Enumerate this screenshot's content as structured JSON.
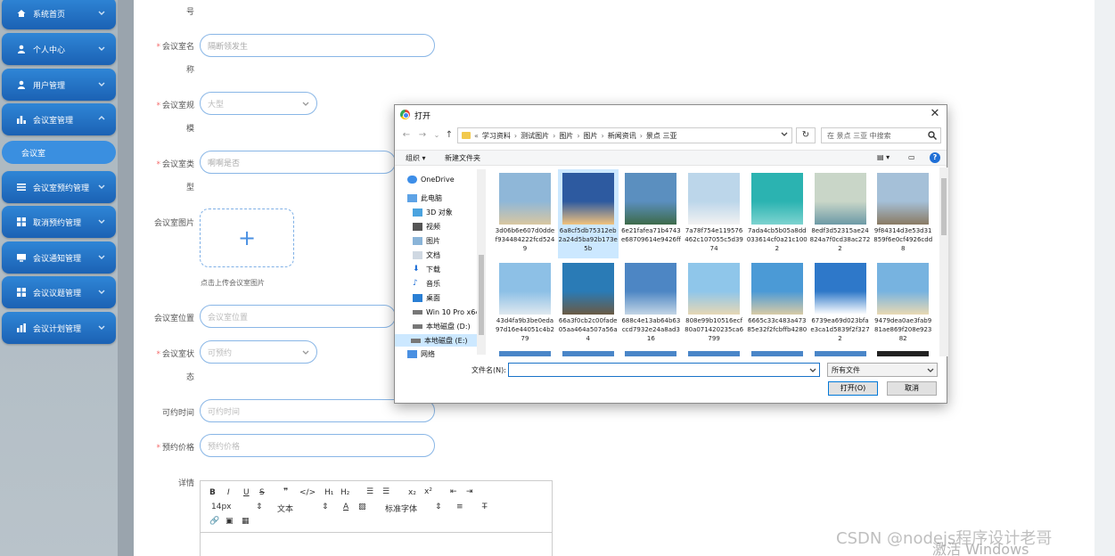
{
  "sidebar": {
    "items": [
      {
        "label": "系统首页",
        "icon": "home-icon"
      },
      {
        "label": "个人中心",
        "icon": "user-icon"
      },
      {
        "label": "用户管理",
        "icon": "user-icon"
      },
      {
        "label": "会议室管理",
        "icon": "chart-icon"
      },
      {
        "label": "会议室预约管理",
        "icon": "list-icon"
      },
      {
        "label": "取消预约管理",
        "icon": "grid-icon"
      },
      {
        "label": "会议通知管理",
        "icon": "monitor-icon"
      },
      {
        "label": "会议议题管理",
        "icon": "grid-icon"
      },
      {
        "label": "会议计划管理",
        "icon": "bar-chart-icon"
      }
    ],
    "submenu_label": "会议室"
  },
  "form": {
    "top_fragment": "号",
    "name_label": "会议室名",
    "name_label_wrap": "称",
    "name_value": "隔断领发生",
    "type_label": "会议室规",
    "type_label_wrap": "模",
    "type_value": "大型",
    "category_label": "会议室类",
    "category_label_wrap": "型",
    "category_value": "啊啊是否",
    "image_label": "会议室图片",
    "upload_hint": "点击上传会议室图片",
    "location_label": "会议室位置",
    "location_placeholder": "会议室位置",
    "status_label": "会议室状",
    "status_label_wrap": "态",
    "status_value": "可预约",
    "time_label": "可约时间",
    "time_placeholder": "可约时间",
    "price_label": "预约价格",
    "price_placeholder": "预约价格",
    "detail_label": "详情",
    "editor": {
      "font_size": "14px",
      "text_type": "文本",
      "font_family": "标准字体"
    }
  },
  "dialog": {
    "title": "打开",
    "breadcrumb": [
      "学习资料",
      "测试图片",
      "图片",
      "图片",
      "新闻资讯",
      "景点 三亚"
    ],
    "search_placeholder": "在 景点 三亚 中搜索",
    "organize": "组织 ▾",
    "new_folder": "新建文件夹",
    "nav_items": [
      {
        "label": "OneDrive",
        "icon": "cloud-icon"
      },
      {
        "label": "此电脑",
        "icon": "computer-icon"
      },
      {
        "label": "3D 对象",
        "icon": "cube-icon"
      },
      {
        "label": "视频",
        "icon": "video-icon"
      },
      {
        "label": "图片",
        "icon": "picture-icon"
      },
      {
        "label": "文档",
        "icon": "document-icon"
      },
      {
        "label": "下载",
        "icon": "download-icon"
      },
      {
        "label": "音乐",
        "icon": "music-icon"
      },
      {
        "label": "桌面",
        "icon": "desktop-icon"
      },
      {
        "label": "Win 10 Pro x64",
        "icon": "drive-icon"
      },
      {
        "label": "本地磁盘 (D:)",
        "icon": "drive-icon"
      },
      {
        "label": "本地磁盘 (E:)",
        "icon": "drive-icon"
      },
      {
        "label": "网络",
        "icon": "network-icon"
      }
    ],
    "files": [
      {
        "name": "3d06b6e607d0ddef934484222fcd5249",
        "c1": "#8fb7d8",
        "c2": "#d9c7a1"
      },
      {
        "name": "6a8cf5db75312eb2a24d5ba92b173e5b",
        "c1": "#2d5aa0",
        "c2": "#f1c27d"
      },
      {
        "name": "6e21fafea71b4743e68709614e9426ff",
        "c1": "#5b8fbf",
        "c2": "#3d6b4a"
      },
      {
        "name": "7a78f754e119576462c107055c5d3974",
        "c1": "#bcd6ea",
        "c2": "#f2f2f2"
      },
      {
        "name": "7ada4cb5b05a8dd033614cf0a21c1002",
        "c1": "#2bb3b1",
        "c2": "#7dd3d0"
      },
      {
        "name": "8edf3d52315ae24824a7f0cd38ac2722",
        "c1": "#c9d6c8",
        "c2": "#6c9aa6"
      },
      {
        "name": "9f84314d3e53d31859f6e0cf4926cdd8",
        "c1": "#a5c0d8",
        "c2": "#8a7a63"
      },
      {
        "name": "43d4fa9b3be0eda97d16e44051c4b279",
        "c1": "#8dc0e6",
        "c2": "#dfe8ef"
      },
      {
        "name": "66a3f0cb2c00fade05aa464a507a56a4",
        "c1": "#2a7bb6",
        "c2": "#6a5a44"
      },
      {
        "name": "688c4e13ab64b63ccd7932e24a8ad316",
        "c1": "#4d86c4",
        "c2": "#c2d5e5"
      },
      {
        "name": "808e99b10516ecf80a071420235ca6799",
        "c1": "#8fc6ea",
        "c2": "#e6d7b5"
      },
      {
        "name": "6665c33c483a47385e32f2fcbffb4280",
        "c1": "#4b9ad6",
        "c2": "#d8cba6"
      },
      {
        "name": "6739ea69d023bfae3ca1d5839f2f3272",
        "c1": "#2e78c9",
        "c2": "#ffffff"
      },
      {
        "name": "9479dea0ae3fab981ae869f208e92382",
        "c1": "#77b3e0",
        "c2": "#e9d9b3"
      }
    ],
    "filename_label": "文件名(N):",
    "filename_value": "",
    "filetype": "所有文件",
    "open_button": "打开(O)",
    "cancel_button": "取消"
  },
  "watermark": "CSDN @nodejs程序设计老哥",
  "activate_text": "激活 Windows",
  "colors": {
    "accent": "#1b62b4",
    "field_border": "#89b6e6",
    "required": "#f56c6c"
  }
}
